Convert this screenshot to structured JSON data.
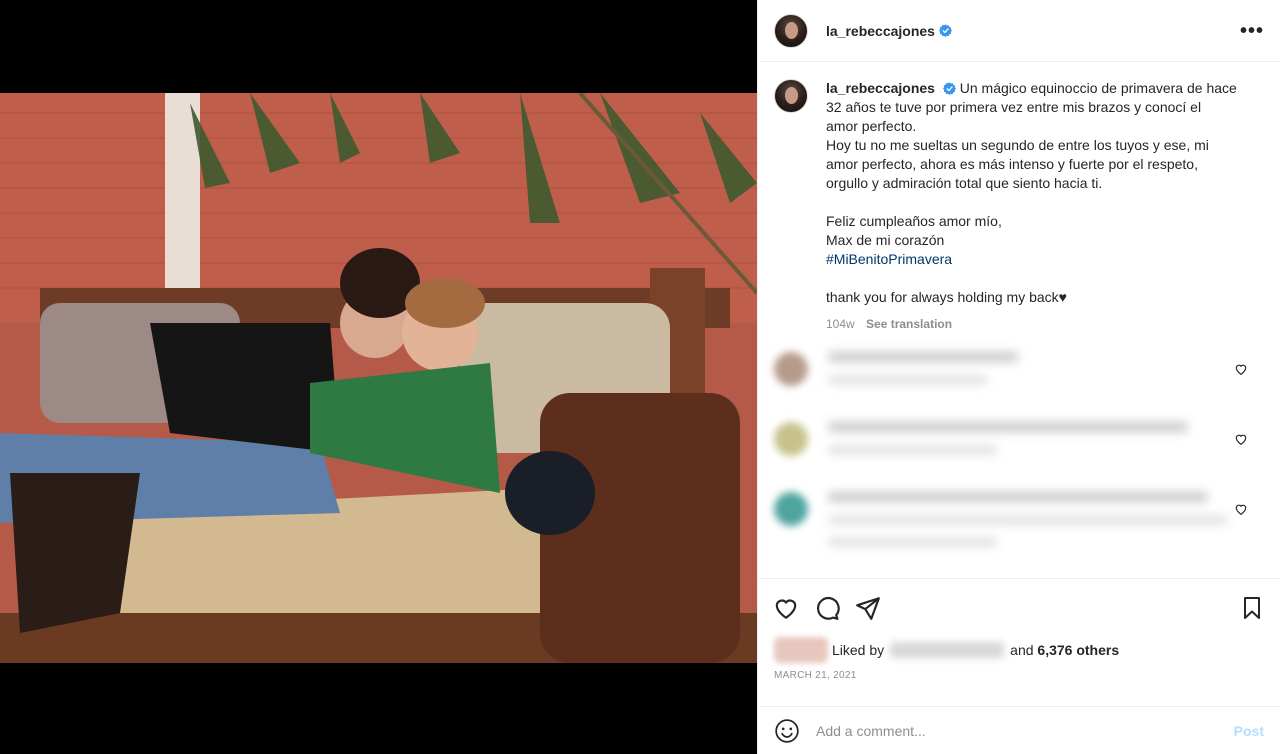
{
  "post": {
    "username": "la_rebeccajones",
    "more_icon": "•••",
    "caption_lines": [
      "Un mágico equinoccio de primavera de hace",
      "32 años te tuve por primera vez entre mis brazos y conocí el",
      "amor perfecto.",
      "Hoy tu no me sueltas un segundo de entre los tuyos y ese, mi",
      "amor perfecto, ahora es más intenso y fuerte por el respeto,",
      "orgullo y admiración total que siento hacia ti."
    ],
    "caption_lines_2": [
      "Feliz cumpleaños amor mío,",
      "Max de mi corazón"
    ],
    "hashtag": "#MiBenitoPrimavera",
    "caption_english": "thank you for always holding my back♥",
    "age": "104w",
    "see_translation": "See translation",
    "liked_by_label": "Liked by",
    "and_label": "and",
    "others": "6,376 others",
    "date": "March 21, 2021",
    "comment_placeholder": "Add a comment...",
    "post_label": "Post"
  },
  "colors": {
    "verified": "#3897f0",
    "hashtag": "#00376b",
    "post_button": "#b2dffc"
  }
}
